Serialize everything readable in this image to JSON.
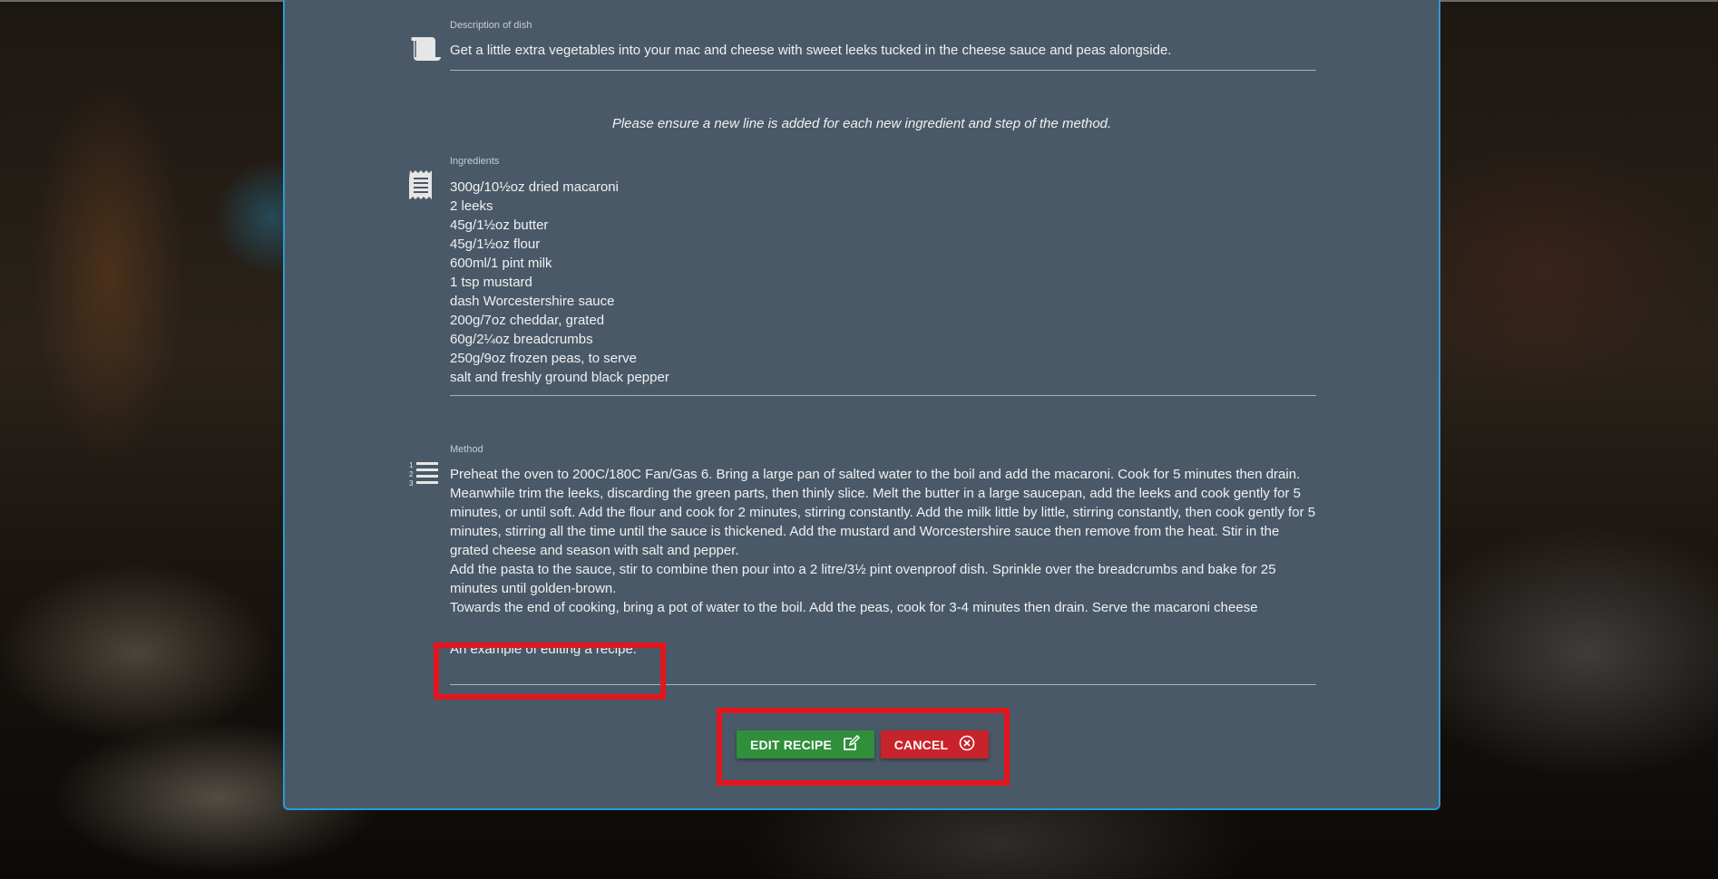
{
  "description": {
    "label": "Description of dish",
    "value": "Get a little extra vegetables into your mac and cheese with sweet leeks tucked in the cheese sauce and peas alongside."
  },
  "hint": "Please ensure a new line is added for each new ingredient and step of the method.",
  "ingredients": {
    "label": "Ingredients",
    "items": [
      "300g/10½oz dried macaroni",
      "2 leeks",
      "45g/1½oz butter",
      "45g/1½oz flour",
      "600ml/1 pint milk",
      "1 tsp mustard",
      "dash Worcestershire sauce",
      "200g/7oz cheddar, grated",
      "60g/2¼oz breadcrumbs",
      "250g/9oz frozen peas, to serve",
      "salt and freshly ground black pepper"
    ]
  },
  "method": {
    "label": "Method",
    "steps": [
      "Preheat the oven to 200C/180C Fan/Gas 6. Bring a large pan of salted water to the boil and add the macaroni. Cook for 5 minutes then drain.",
      "Meanwhile trim the leeks, discarding the green parts, then thinly slice. Melt the butter in a large saucepan, add the leeks and cook gently for 5 minutes, or until soft. Add the flour and cook for 2 minutes, stirring constantly. Add the milk little by little, stirring constantly, then cook gently for 5 minutes, stirring all the time until the sauce is thickened. Add the mustard and Worcestershire sauce then remove from the heat. Stir in the grated cheese and season with salt and pepper.",
      "Add the pasta to the sauce, stir to combine then pour into a 2 litre/3½ pint ovenproof dish. Sprinkle over the breadcrumbs and bake for 25 minutes until golden-brown.",
      "Towards the end of cooking, bring a pot of water to the boil. Add the peas, cook for 3-4 minutes then drain. Serve the macaroni cheese"
    ],
    "added_line": "An example of editing a recipe."
  },
  "buttons": {
    "edit": "EDIT RECIPE",
    "cancel": "CANCEL"
  },
  "icons": {
    "description": "scroll-icon",
    "ingredients": "receipt-icon",
    "method": "numbered-list-icon",
    "edit": "edit-icon",
    "cancel": "cancel-circle-icon"
  },
  "colors": {
    "panel": "#4a5967",
    "panel_border": "#2a9bd1",
    "edit_button": "#2f8f3b",
    "cancel_button": "#c8232b",
    "highlight": "#e3151f"
  }
}
